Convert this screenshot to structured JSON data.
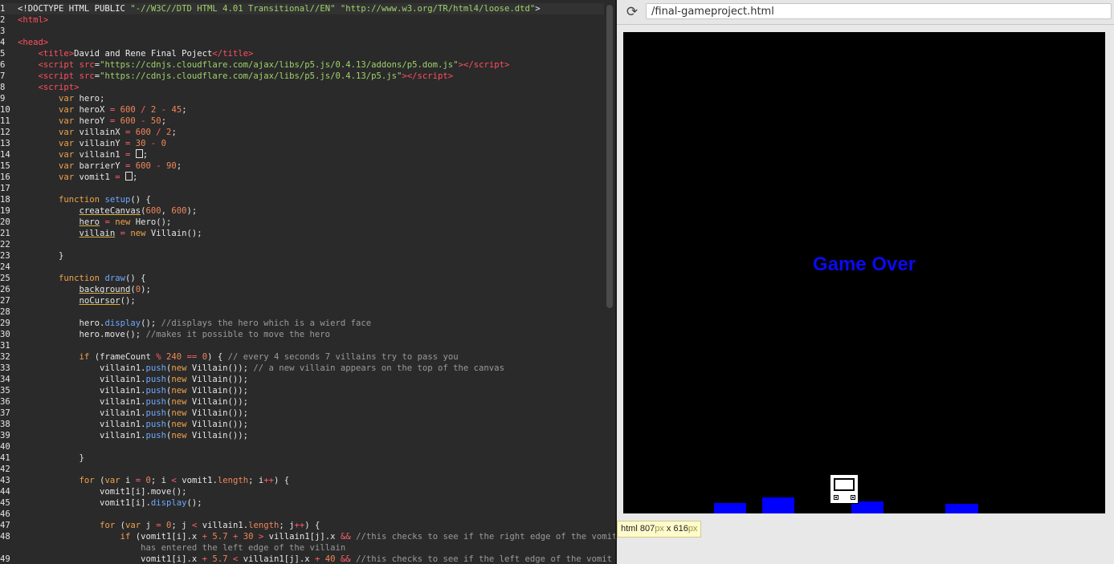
{
  "editor": {
    "lines": [
      {
        "n": "1",
        "html": "<span class=\"plain\">&lt;!DOCTYPE HTML PUBLIC </span><span class=\"str\">\"-//W3C//DTD HTML 4.01 Transitional//EN\"</span><span class=\"plain\"> </span><span class=\"str\">\"http://www.w3.org/TR/html4/loose.dtd\"</span><span class=\"plain\">&gt;</span>",
        "active": true
      },
      {
        "n": "2",
        "html": "<span class=\"tag\">&lt;html&gt;</span>"
      },
      {
        "n": "3",
        "html": ""
      },
      {
        "n": "4",
        "html": "<span class=\"tag\">&lt;head&gt;</span>"
      },
      {
        "n": "5",
        "html": "    <span class=\"tag\">&lt;title&gt;</span><span class=\"plain\">David and Rene Final Poject</span><span class=\"tag\">&lt;/title&gt;</span>"
      },
      {
        "n": "6",
        "html": "    <span class=\"tag\">&lt;script</span> <span class=\"tag\">src</span><span class=\"plain\">=</span><span class=\"str\">\"https://cdnjs.cloudflare.com/ajax/libs/p5.js/0.4.13/addons/p5.dom.js\"</span><span class=\"tag\">&gt;&lt;/script&gt;</span>"
      },
      {
        "n": "7",
        "html": "    <span class=\"tag\">&lt;script</span> <span class=\"tag\">src</span><span class=\"plain\">=</span><span class=\"str\">\"https://cdnjs.cloudflare.com/ajax/libs/p5.js/0.4.13/p5.js\"</span><span class=\"tag\">&gt;&lt;/script&gt;</span>"
      },
      {
        "n": "8",
        "html": "    <span class=\"tag\">&lt;script&gt;</span>"
      },
      {
        "n": "9",
        "html": "        <span class=\"kw\">var</span> hero;"
      },
      {
        "n": "10",
        "html": "        <span class=\"kw\">var</span> heroX <span class=\"op\">=</span> <span class=\"num\">600</span> <span class=\"op\">/</span> <span class=\"num\">2</span> <span class=\"op\">-</span> <span class=\"num\">45</span>;"
      },
      {
        "n": "11",
        "html": "        <span class=\"kw\">var</span> heroY <span class=\"op\">=</span> <span class=\"num\">600</span> <span class=\"op\">-</span> <span class=\"num\">50</span>;"
      },
      {
        "n": "12",
        "html": "        <span class=\"kw\">var</span> villainX <span class=\"op\">=</span> <span class=\"num\">600</span> <span class=\"op\">/</span> <span class=\"num\">2</span>;"
      },
      {
        "n": "13",
        "html": "        <span class=\"kw\">var</span> villainY <span class=\"op\">=</span> <span class=\"num\">30</span> <span class=\"op\">-</span> <span class=\"num\">0</span>"
      },
      {
        "n": "14",
        "html": "        <span class=\"kw\">var</span> villain1 <span class=\"op\">=</span> <span class=\"cursor-box\"></span>;"
      },
      {
        "n": "15",
        "html": "        <span class=\"kw\">var</span> barrierY <span class=\"op\">=</span> <span class=\"num\">600</span> <span class=\"op\">-</span> <span class=\"num\">90</span>;"
      },
      {
        "n": "16",
        "html": "        <span class=\"kw\">var</span> vomit1 <span class=\"op\">=</span> <span class=\"cursor-box\"></span>;"
      },
      {
        "n": "17",
        "html": ""
      },
      {
        "n": "18",
        "html": "        <span class=\"kw\">function</span> <span class=\"fn\">setup</span>() {"
      },
      {
        "n": "19",
        "html": "            <span class=\"ul\">createCanvas</span>(<span class=\"num\">600</span>, <span class=\"num\">600</span>);"
      },
      {
        "n": "20",
        "html": "            <span class=\"ul\">hero</span> <span class=\"op\">=</span> <span class=\"kw\">new</span> Hero();"
      },
      {
        "n": "21",
        "html": "            <span class=\"ul\">villain</span> <span class=\"op\">=</span> <span class=\"kw\">new</span> Villain();"
      },
      {
        "n": "22",
        "html": ""
      },
      {
        "n": "23",
        "html": "        }"
      },
      {
        "n": "24",
        "html": ""
      },
      {
        "n": "25",
        "html": "        <span class=\"kw\">function</span> <span class=\"fn\">draw</span>() {"
      },
      {
        "n": "26",
        "html": "            <span class=\"ul\">background</span>(<span class=\"num\">0</span>);"
      },
      {
        "n": "27",
        "html": "            <span class=\"ul\">noCursor</span>();"
      },
      {
        "n": "28",
        "html": ""
      },
      {
        "n": "29",
        "html": "            hero.<span class=\"fn\">display</span>(); <span class=\"cmt\">//displays the hero which is a wierd face</span>"
      },
      {
        "n": "30",
        "html": "            hero.move(); <span class=\"cmt\">//makes it possible to move the hero</span>"
      },
      {
        "n": "31",
        "html": ""
      },
      {
        "n": "32",
        "html": "            <span class=\"kw\">if</span> (frameCount <span class=\"op\">%</span> <span class=\"num\">240</span> <span class=\"op\">==</span> <span class=\"num\">0</span>) { <span class=\"cmt\">// every 4 seconds 7 villains try to pass you</span>"
      },
      {
        "n": "33",
        "html": "                villain1.<span class=\"fn\">push</span>(<span class=\"kw\">new</span> Villain()); <span class=\"cmt\">// a new villain appears on the top of the canvas</span>"
      },
      {
        "n": "34",
        "html": "                villain1.<span class=\"fn\">push</span>(<span class=\"kw\">new</span> Villain());"
      },
      {
        "n": "35",
        "html": "                villain1.<span class=\"fn\">push</span>(<span class=\"kw\">new</span> Villain());"
      },
      {
        "n": "36",
        "html": "                villain1.<span class=\"fn\">push</span>(<span class=\"kw\">new</span> Villain());"
      },
      {
        "n": "37",
        "html": "                villain1.<span class=\"fn\">push</span>(<span class=\"kw\">new</span> Villain());"
      },
      {
        "n": "38",
        "html": "                villain1.<span class=\"fn\">push</span>(<span class=\"kw\">new</span> Villain());"
      },
      {
        "n": "39",
        "html": "                villain1.<span class=\"fn\">push</span>(<span class=\"kw\">new</span> Villain());"
      },
      {
        "n": "40",
        "html": ""
      },
      {
        "n": "41",
        "html": "            }"
      },
      {
        "n": "42",
        "html": ""
      },
      {
        "n": "43",
        "html": "            <span class=\"kw\">for</span> (<span class=\"kw\">var</span> i <span class=\"op\">=</span> <span class=\"num\">0</span>; i <span class=\"op\">&lt;</span> vomit1.<span class=\"num\">length</span>; i<span class=\"op\">++</span>) {"
      },
      {
        "n": "44",
        "html": "                vomit1[i].move();"
      },
      {
        "n": "45",
        "html": "                vomit1[i].<span class=\"fn\">display</span>();"
      },
      {
        "n": "46",
        "html": ""
      },
      {
        "n": "47",
        "html": "                <span class=\"kw\">for</span> (<span class=\"kw\">var</span> j <span class=\"op\">=</span> <span class=\"num\">0</span>; j <span class=\"op\">&lt;</span> villain1.<span class=\"num\">length</span>; j<span class=\"op\">++</span>) {"
      },
      {
        "n": "48",
        "html": "                    <span class=\"kw\">if</span> (vomit1[i].x <span class=\"op\">+</span> <span class=\"num\">5.7</span> <span class=\"op\">+</span> <span class=\"num\">30</span> <span class=\"op\">&gt;</span> villain1[j].x <span class=\"op\">&amp;&amp;</span> <span class=\"cmt\">//this checks to see if the right edge of the vomit</span>"
      },
      {
        "n": "",
        "html": "                        <span class=\"cmt\">has entered the left edge of the villain</span>"
      },
      {
        "n": "49",
        "html": "                        vomit1[i].x <span class=\"op\">+</span> <span class=\"num\">5.7</span> <span class=\"op\">&lt;</span> villain1[j].x <span class=\"op\">+</span> <span class=\"num\">40</span> <span class=\"op\">&amp;&amp;</span> <span class=\"cmt\">//this checks to see if the left edge of the vomit has</span>"
      }
    ]
  },
  "browser": {
    "reload_icon": "reload-icon",
    "url": "/final-gameproject.html",
    "game": {
      "message": "Game Over",
      "colors": {
        "canvas": "#000000",
        "blocks": "#0000ff",
        "text": "#0a0af0"
      }
    },
    "inspector": {
      "tag": "html",
      "width": "807",
      "height": "616",
      "unit": "px",
      "sep": " x "
    }
  }
}
